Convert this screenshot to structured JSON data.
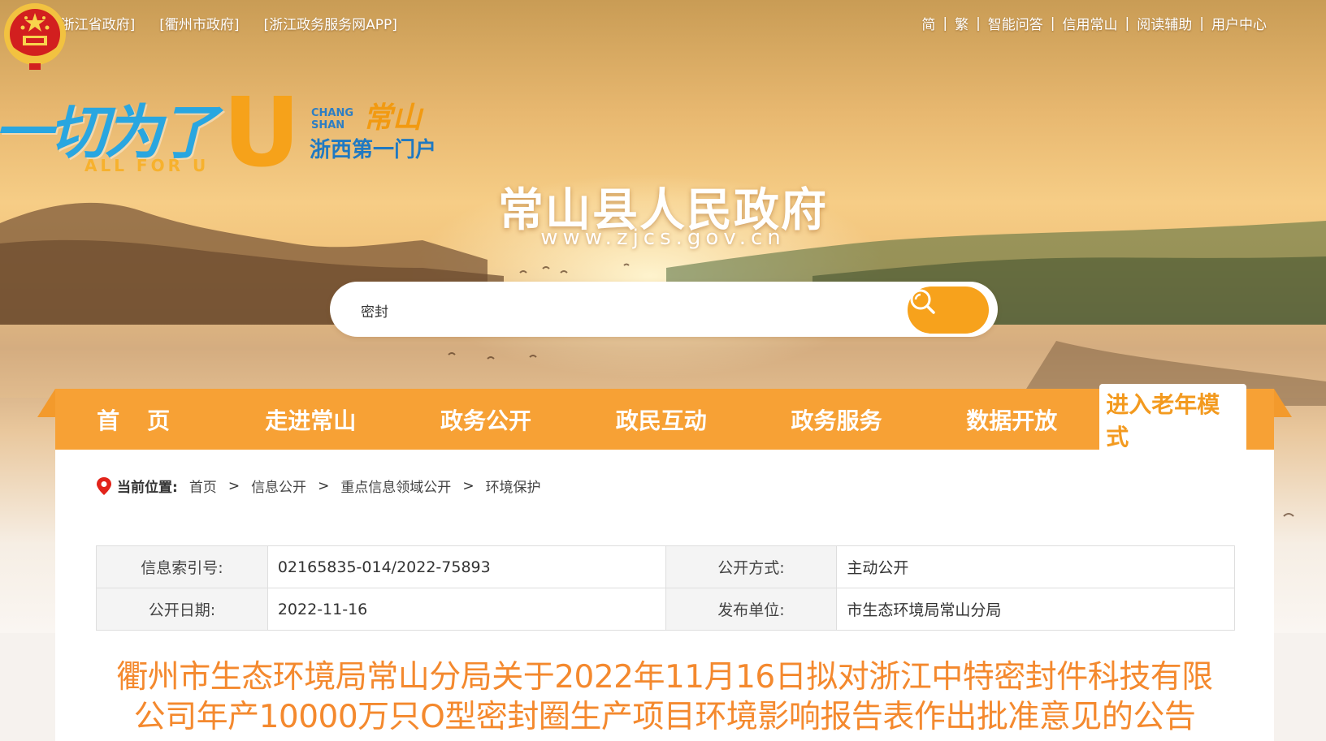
{
  "top_links": [
    "[浙江省政府]",
    "[衢州市政府]",
    "[浙江政务服务网APP]"
  ],
  "top_right_links": [
    "简",
    "繁",
    "智能问答",
    "信用常山",
    "阅读辅助",
    "用户中心"
  ],
  "slogan": {
    "main": "一切为了",
    "u": "U",
    "en": "ALL FOR U",
    "place_en": "CHANG\nSHAN",
    "place_cn": "常山",
    "tagline": "浙西第一门户"
  },
  "site": {
    "title": "常山县人民政府",
    "url": "www.zjcs.gov.cn"
  },
  "search": {
    "value": "密封"
  },
  "nav": {
    "items": [
      "首页",
      "走进常山",
      "政务公开",
      "政民互动",
      "政务服务",
      "数据开放"
    ],
    "elder_mode": "进入老年模式"
  },
  "breadcrumb": {
    "label": "当前位置:",
    "items": [
      "首页",
      "信息公开",
      "重点信息领域公开",
      "环境保护"
    ],
    "separator": ">"
  },
  "meta": {
    "index_label": "信息索引号:",
    "index_value": "02165835-014/2022-75893",
    "method_label": "公开方式:",
    "method_value": "主动公开",
    "date_label": "公开日期:",
    "date_value": "2022-11-16",
    "publisher_label": "发布单位:",
    "publisher_value": "市生态环境局常山分局"
  },
  "article": {
    "title_line1": "衢州市生态环境局常山分局关于2022年11月16日拟对浙江中特密封件科技有限",
    "title_line2": "公司年产10000万只O型密封圈生产项目环境影响报告表作出批准意见的公告"
  },
  "colors": {
    "nav": "#f7a135",
    "accent": "#f39a1f",
    "title": "#f4892e"
  }
}
